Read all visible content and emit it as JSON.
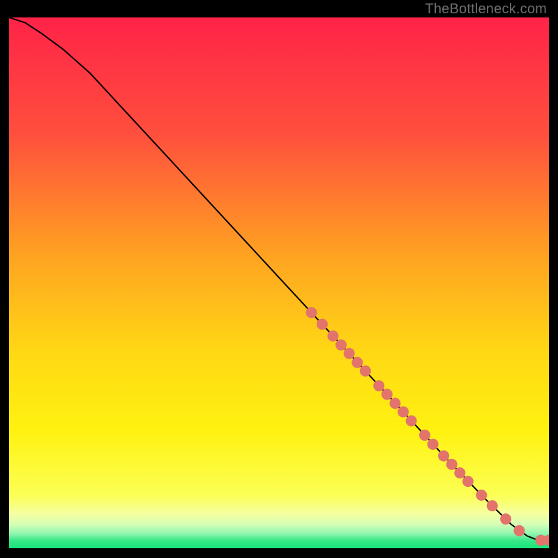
{
  "attribution": "TheBottleneck.com",
  "colors": {
    "frame": "#000000",
    "curve": "#000000",
    "marker": "#e2746c",
    "attribution_text": "#6f6f6f"
  },
  "chart_data": {
    "type": "line",
    "title": "",
    "xlabel": "",
    "ylabel": "",
    "xlim": [
      0,
      100
    ],
    "ylim": [
      0,
      100
    ],
    "grid": false,
    "background_gradient": {
      "stops": [
        {
          "offset": 0.0,
          "color": "#ff2348"
        },
        {
          "offset": 0.22,
          "color": "#ff4f3d"
        },
        {
          "offset": 0.45,
          "color": "#ffa321"
        },
        {
          "offset": 0.63,
          "color": "#ffd814"
        },
        {
          "offset": 0.78,
          "color": "#fff210"
        },
        {
          "offset": 0.9,
          "color": "#fcff55"
        },
        {
          "offset": 0.935,
          "color": "#f5ffa0"
        },
        {
          "offset": 0.955,
          "color": "#d4ffb5"
        },
        {
          "offset": 0.972,
          "color": "#93f6b0"
        },
        {
          "offset": 0.985,
          "color": "#3ae888"
        },
        {
          "offset": 1.0,
          "color": "#15e47a"
        }
      ]
    },
    "series": [
      {
        "name": "curve",
        "x": [
          0,
          3,
          6,
          10,
          15,
          20,
          30,
          40,
          50,
          60,
          70,
          80,
          88,
          93,
          96,
          98,
          100
        ],
        "y": [
          100,
          99,
          97,
          94,
          89.5,
          84,
          73,
          62,
          51,
          40,
          29,
          18,
          9.5,
          4.5,
          2.3,
          1.5,
          1.5
        ]
      }
    ],
    "markers": [
      {
        "x": 56.0,
        "y": 44.4
      },
      {
        "x": 58.0,
        "y": 42.2
      },
      {
        "x": 60.0,
        "y": 40.0
      },
      {
        "x": 61.5,
        "y": 38.3
      },
      {
        "x": 63.0,
        "y": 36.7
      },
      {
        "x": 64.5,
        "y": 35.0
      },
      {
        "x": 66.0,
        "y": 33.4
      },
      {
        "x": 68.5,
        "y": 30.6
      },
      {
        "x": 70.0,
        "y": 29.0
      },
      {
        "x": 71.5,
        "y": 27.3
      },
      {
        "x": 73.0,
        "y": 25.7
      },
      {
        "x": 74.5,
        "y": 24.0
      },
      {
        "x": 77.0,
        "y": 21.3
      },
      {
        "x": 78.5,
        "y": 19.6
      },
      {
        "x": 80.5,
        "y": 17.4
      },
      {
        "x": 82.0,
        "y": 15.8
      },
      {
        "x": 83.5,
        "y": 14.2
      },
      {
        "x": 85.0,
        "y": 12.6
      },
      {
        "x": 87.5,
        "y": 10.0
      },
      {
        "x": 89.5,
        "y": 8.0
      },
      {
        "x": 92.0,
        "y": 5.5
      },
      {
        "x": 94.5,
        "y": 3.3
      },
      {
        "x": 98.5,
        "y": 1.5
      },
      {
        "x": 100.0,
        "y": 1.5
      }
    ]
  }
}
